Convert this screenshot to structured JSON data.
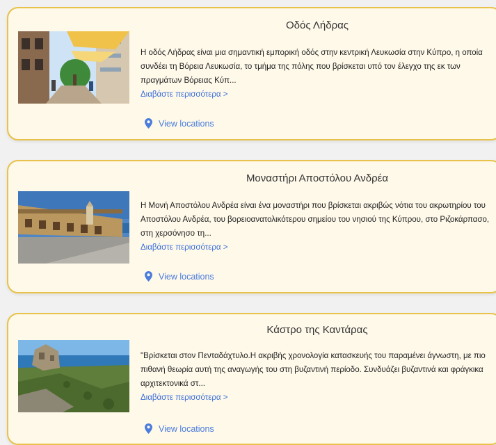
{
  "cards": [
    {
      "title": "Οδός Λήδρας",
      "description": "Η οδός Λήδρας είναι μια σημαντική εμπορική οδός στην κεντρική Λευκωσία στην Κύπρο, η οποία συνδέει τη Βόρεια Λευκωσία, το τμήμα της πόλης που βρίσκεται υπό τον έλεγχο της εκ των πραγμάτων Βόρειας Κύπ...",
      "read_more": "Διαβάστε περισσότερα >",
      "locations": "View locations"
    },
    {
      "title": "Μοναστήρι Αποστόλου Ανδρέα",
      "description": "Η Μονή Αποστόλου Ανδρέα είναι ένα μοναστήρι που βρίσκεται ακριβώς νότια του ακρωτηρίου του Αποστόλου Ανδρέα, του βορειοανατολικότερου σημείου του νησιού της Κύπρου, στο Ριζοκάρπασο, στη χερσόνησο τη...",
      "read_more": "Διαβάστε περισσότερα >",
      "locations": "View locations"
    },
    {
      "title": "Κάστρο της Καντάρας",
      "description": "\"Βρίσκεται στον Πενταδάχτυλο.Η ακριβής χρονολογία κατασκευής του παραμένει άγνωστη, με πιο πιθανή θεωρία αυτή της αναγωγής του στη βυζαντινή περίοδο. Συνδυάζει βυζαντινά και φράγκικα αρχιτεκτονικά στ...",
      "read_more": "Διαβάστε περισσότερα >",
      "locations": "View locations"
    }
  ],
  "colors": {
    "card_bg": "#fff9ea",
    "card_border": "#e8c24a",
    "link": "#3b6fd8"
  }
}
